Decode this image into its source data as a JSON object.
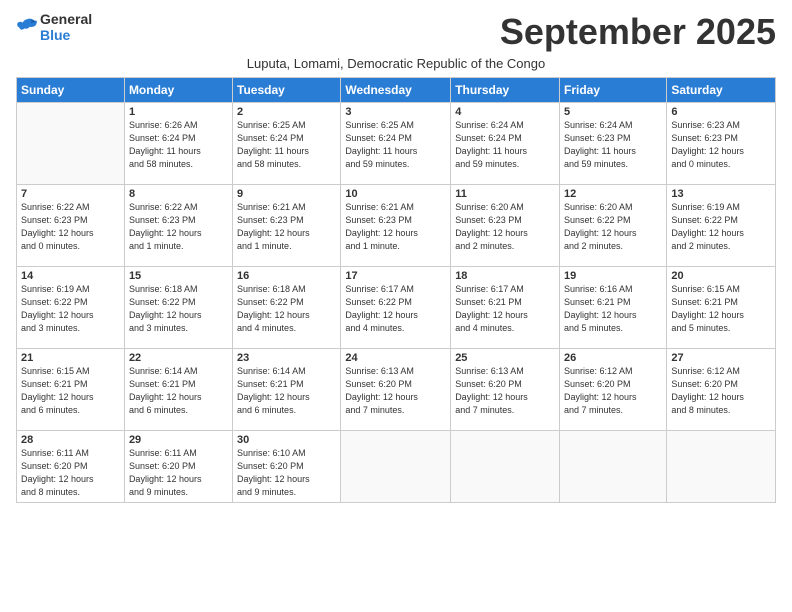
{
  "logo": {
    "general": "General",
    "blue": "Blue"
  },
  "header": {
    "month_title": "September 2025",
    "subtitle": "Luputa, Lomami, Democratic Republic of the Congo"
  },
  "days_of_week": [
    "Sunday",
    "Monday",
    "Tuesday",
    "Wednesday",
    "Thursday",
    "Friday",
    "Saturday"
  ],
  "weeks": [
    [
      {
        "day": "",
        "info": ""
      },
      {
        "day": "1",
        "info": "Sunrise: 6:26 AM\nSunset: 6:24 PM\nDaylight: 11 hours\nand 58 minutes."
      },
      {
        "day": "2",
        "info": "Sunrise: 6:25 AM\nSunset: 6:24 PM\nDaylight: 11 hours\nand 58 minutes."
      },
      {
        "day": "3",
        "info": "Sunrise: 6:25 AM\nSunset: 6:24 PM\nDaylight: 11 hours\nand 59 minutes."
      },
      {
        "day": "4",
        "info": "Sunrise: 6:24 AM\nSunset: 6:24 PM\nDaylight: 11 hours\nand 59 minutes."
      },
      {
        "day": "5",
        "info": "Sunrise: 6:24 AM\nSunset: 6:23 PM\nDaylight: 11 hours\nand 59 minutes."
      },
      {
        "day": "6",
        "info": "Sunrise: 6:23 AM\nSunset: 6:23 PM\nDaylight: 12 hours\nand 0 minutes."
      }
    ],
    [
      {
        "day": "7",
        "info": "Sunrise: 6:22 AM\nSunset: 6:23 PM\nDaylight: 12 hours\nand 0 minutes."
      },
      {
        "day": "8",
        "info": "Sunrise: 6:22 AM\nSunset: 6:23 PM\nDaylight: 12 hours\nand 1 minute."
      },
      {
        "day": "9",
        "info": "Sunrise: 6:21 AM\nSunset: 6:23 PM\nDaylight: 12 hours\nand 1 minute."
      },
      {
        "day": "10",
        "info": "Sunrise: 6:21 AM\nSunset: 6:23 PM\nDaylight: 12 hours\nand 1 minute."
      },
      {
        "day": "11",
        "info": "Sunrise: 6:20 AM\nSunset: 6:23 PM\nDaylight: 12 hours\nand 2 minutes."
      },
      {
        "day": "12",
        "info": "Sunrise: 6:20 AM\nSunset: 6:22 PM\nDaylight: 12 hours\nand 2 minutes."
      },
      {
        "day": "13",
        "info": "Sunrise: 6:19 AM\nSunset: 6:22 PM\nDaylight: 12 hours\nand 2 minutes."
      }
    ],
    [
      {
        "day": "14",
        "info": "Sunrise: 6:19 AM\nSunset: 6:22 PM\nDaylight: 12 hours\nand 3 minutes."
      },
      {
        "day": "15",
        "info": "Sunrise: 6:18 AM\nSunset: 6:22 PM\nDaylight: 12 hours\nand 3 minutes."
      },
      {
        "day": "16",
        "info": "Sunrise: 6:18 AM\nSunset: 6:22 PM\nDaylight: 12 hours\nand 4 minutes."
      },
      {
        "day": "17",
        "info": "Sunrise: 6:17 AM\nSunset: 6:22 PM\nDaylight: 12 hours\nand 4 minutes."
      },
      {
        "day": "18",
        "info": "Sunrise: 6:17 AM\nSunset: 6:21 PM\nDaylight: 12 hours\nand 4 minutes."
      },
      {
        "day": "19",
        "info": "Sunrise: 6:16 AM\nSunset: 6:21 PM\nDaylight: 12 hours\nand 5 minutes."
      },
      {
        "day": "20",
        "info": "Sunrise: 6:15 AM\nSunset: 6:21 PM\nDaylight: 12 hours\nand 5 minutes."
      }
    ],
    [
      {
        "day": "21",
        "info": "Sunrise: 6:15 AM\nSunset: 6:21 PM\nDaylight: 12 hours\nand 6 minutes."
      },
      {
        "day": "22",
        "info": "Sunrise: 6:14 AM\nSunset: 6:21 PM\nDaylight: 12 hours\nand 6 minutes."
      },
      {
        "day": "23",
        "info": "Sunrise: 6:14 AM\nSunset: 6:21 PM\nDaylight: 12 hours\nand 6 minutes."
      },
      {
        "day": "24",
        "info": "Sunrise: 6:13 AM\nSunset: 6:20 PM\nDaylight: 12 hours\nand 7 minutes."
      },
      {
        "day": "25",
        "info": "Sunrise: 6:13 AM\nSunset: 6:20 PM\nDaylight: 12 hours\nand 7 minutes."
      },
      {
        "day": "26",
        "info": "Sunrise: 6:12 AM\nSunset: 6:20 PM\nDaylight: 12 hours\nand 7 minutes."
      },
      {
        "day": "27",
        "info": "Sunrise: 6:12 AM\nSunset: 6:20 PM\nDaylight: 12 hours\nand 8 minutes."
      }
    ],
    [
      {
        "day": "28",
        "info": "Sunrise: 6:11 AM\nSunset: 6:20 PM\nDaylight: 12 hours\nand 8 minutes."
      },
      {
        "day": "29",
        "info": "Sunrise: 6:11 AM\nSunset: 6:20 PM\nDaylight: 12 hours\nand 9 minutes."
      },
      {
        "day": "30",
        "info": "Sunrise: 6:10 AM\nSunset: 6:20 PM\nDaylight: 12 hours\nand 9 minutes."
      },
      {
        "day": "",
        "info": ""
      },
      {
        "day": "",
        "info": ""
      },
      {
        "day": "",
        "info": ""
      },
      {
        "day": "",
        "info": ""
      }
    ]
  ]
}
